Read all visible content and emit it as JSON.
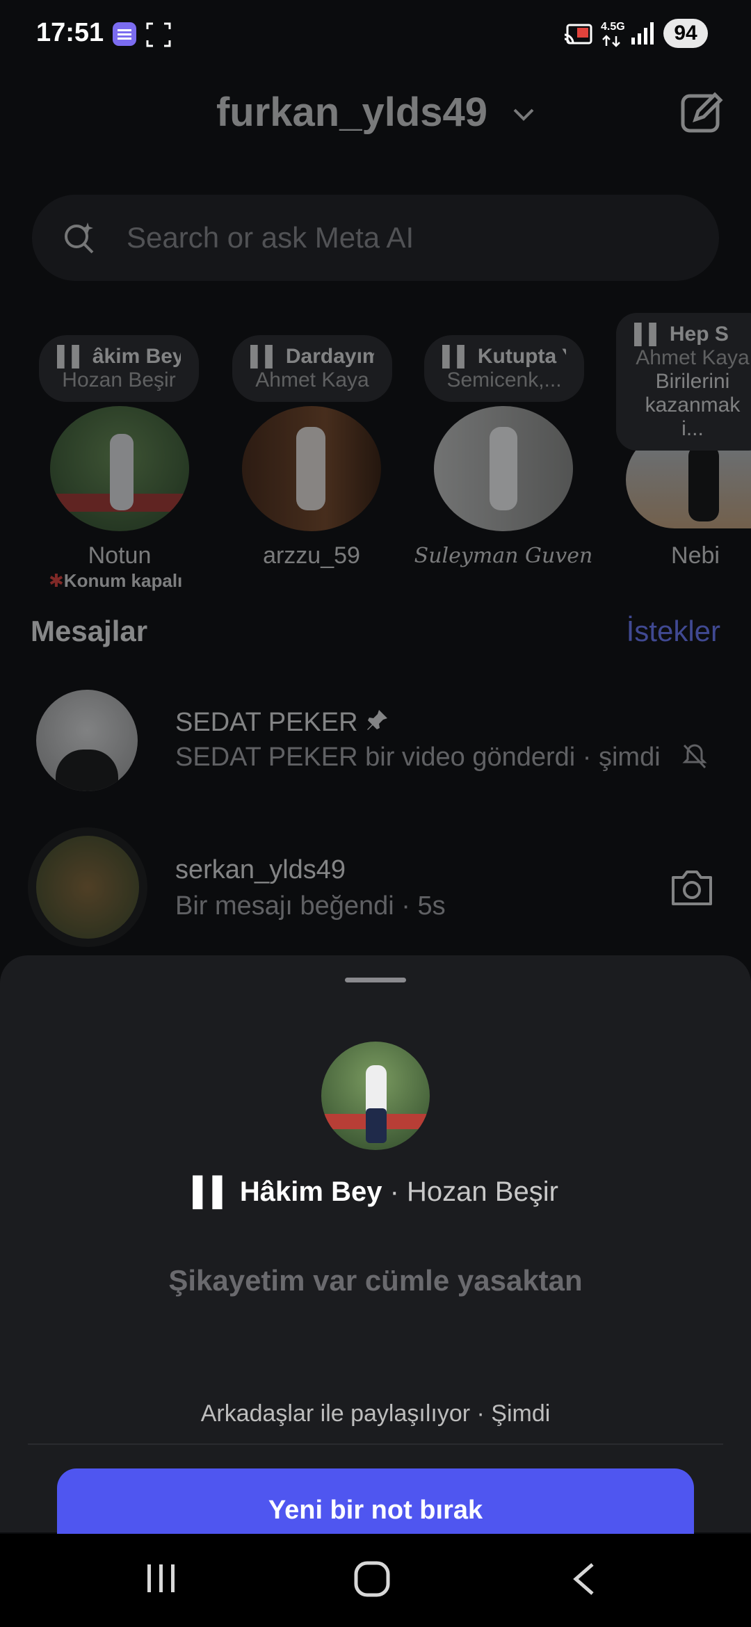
{
  "status_bar": {
    "time": "17:51",
    "network": "4.5G",
    "battery": "94"
  },
  "header": {
    "username": "furkan_ylds49"
  },
  "search": {
    "placeholder": "Search or ask Meta AI"
  },
  "notes": [
    {
      "song": "âkim Bey",
      "artist": "Hozan Beşir",
      "name": "Notun",
      "location": "Konum kapalı"
    },
    {
      "song": "Dardayım",
      "artist": "Ahmet Kaya",
      "name": "arzzu_59"
    },
    {
      "song": "Kutupta Ya",
      "artist": "Semicenk,...",
      "name": "Suleyman Guven"
    },
    {
      "song": "Hep S",
      "artist": "Ahmet Kaya",
      "extra": "Birilerini kazanmak i...",
      "name": "Nebi"
    }
  ],
  "messages_section": {
    "title": "Mesajlar",
    "requests": "İstekler"
  },
  "messages": [
    {
      "name": "SEDAT PEKER",
      "subtitle": "SEDAT PEKER bir video gönderdi · şimdi"
    },
    {
      "name": "serkan_ylds49",
      "subtitle": "Bir mesajı beğendi · 5s"
    }
  ],
  "sheet": {
    "song": "Hâkim Bey",
    "artist": "· Hozan Beşir",
    "note_text": "Şikayetim var cümle yasaktan",
    "shared": "Arkadaşlar ile paylaşılıyor · Şimdi",
    "button": "Yeni bir not bırak"
  },
  "colors": {
    "accent": "#4f56f0",
    "requests": "#6d7cff",
    "background": "#0b0c0e",
    "sheet": "#1b1c1f"
  }
}
